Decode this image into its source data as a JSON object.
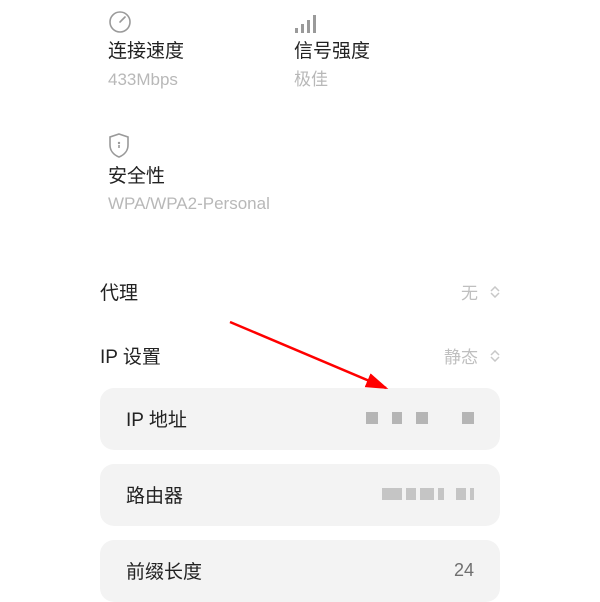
{
  "stats": {
    "speed": {
      "title": "连接速度",
      "value": "433Mbps"
    },
    "signal": {
      "title": "信号强度",
      "value": "极佳"
    },
    "security": {
      "title": "安全性",
      "value": "WPA/WPA2-Personal"
    }
  },
  "rows": {
    "proxy": {
      "label": "代理",
      "value": "无"
    },
    "ip_mode": {
      "label": "IP 设置",
      "value": "静态"
    }
  },
  "cards": {
    "ip_addr": {
      "label": "IP 地址",
      "value": ""
    },
    "router": {
      "label": "路由器",
      "value": ""
    },
    "prefix": {
      "label": "前缀长度",
      "value": "24"
    }
  }
}
